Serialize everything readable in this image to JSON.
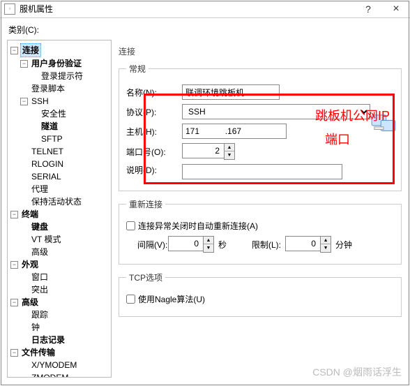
{
  "titlebar": {
    "title": "服机属性",
    "help": "?",
    "close": "×"
  },
  "category_label": "类别(C):",
  "tree": {
    "connection": "连接",
    "auth": "用户身份验证",
    "login_prompt": "登录提示符",
    "login_script": "登录脚本",
    "ssh": "SSH",
    "security": "安全性",
    "tunnel": "隧道",
    "sftp": "SFTP",
    "telnet": "TELNET",
    "rlogin": "RLOGIN",
    "serial": "SERIAL",
    "proxy": "代理",
    "keepalive": "保持活动状态",
    "terminal": "终端",
    "keyboard": "键盘",
    "vtmode": "VT 模式",
    "advanced": "高级",
    "appearance": "外观",
    "window": "窗口",
    "highlight": "突出",
    "advanced2": "高级",
    "trace": "跟踪",
    "bell": "钟",
    "logging": "日志记录",
    "filetransfer": "文件传输",
    "xymodem": "X/YMODEM",
    "zmodem": "ZMODEM"
  },
  "form": {
    "section": "连接",
    "general_group": "常规",
    "name_label": "名称(N):",
    "name_value": "联调环境跳板机",
    "protocol_label": "协议(P):",
    "protocol_value": "SSH",
    "host_label": "主机(H):",
    "host_value": "171           .167",
    "port_label": "端口号(O):",
    "port_value": "2",
    "desc_label": "说明(D):",
    "desc_value": "",
    "reconnect_group": "重新连接",
    "reconnect_check": "连接异常关闭时自动重新连接(A)",
    "interval_label": "间隔(V):",
    "interval_value": "0",
    "seconds": "秒",
    "limit_label": "限制(L):",
    "limit_value": "0",
    "minutes": "分钟",
    "tcp_group": "TCP选项",
    "nagle_check": "使用Nagle算法(U)"
  },
  "annotations": {
    "public_ip": "跳板机公网IP",
    "port": "端口"
  },
  "watermark": "CSDN @烟雨话浮生"
}
